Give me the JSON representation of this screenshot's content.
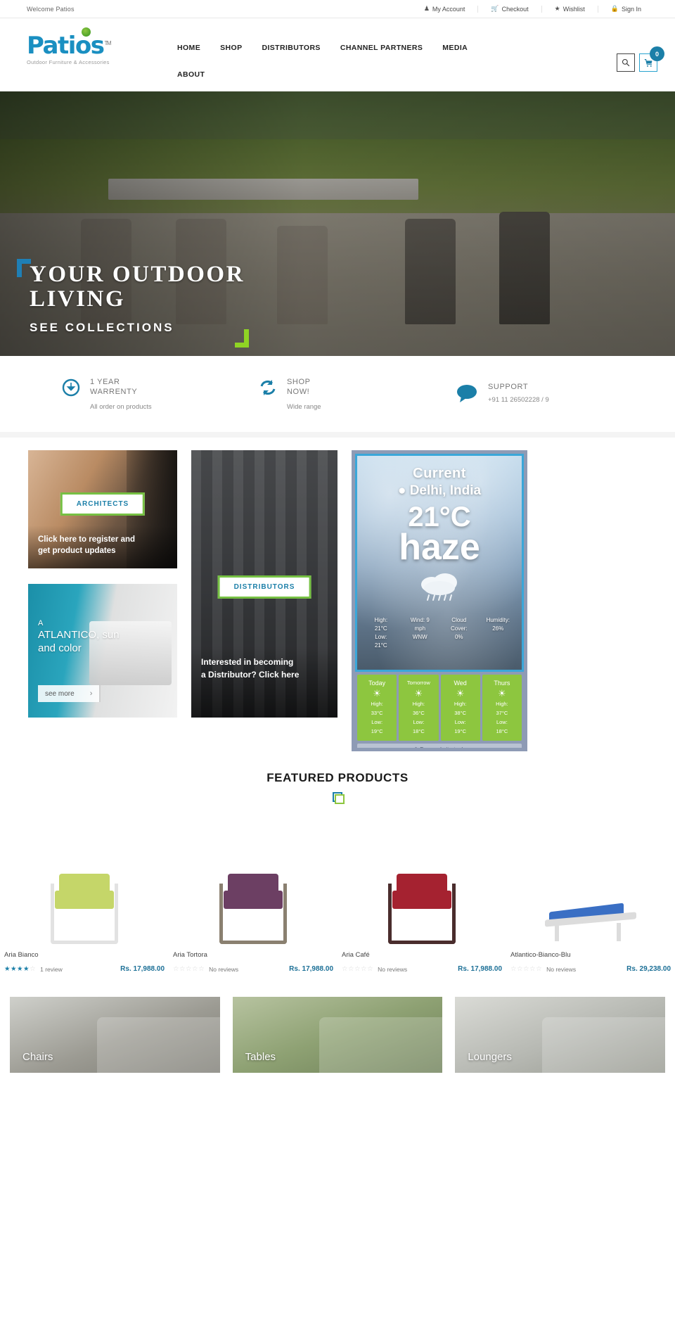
{
  "topbar": {
    "welcome": "Welcome  Patios",
    "links": [
      {
        "label": "My Account",
        "icon": "user-icon",
        "glyph": "●"
      },
      {
        "label": "Checkout",
        "icon": "checkout-icon",
        "glyph": "▤"
      },
      {
        "label": "Wishlist",
        "icon": "star-icon",
        "glyph": "★"
      },
      {
        "label": "Sign In",
        "icon": "lock-icon",
        "glyph": "▮"
      }
    ]
  },
  "header": {
    "logo_text": "Patios",
    "logo_tm": "TM",
    "logo_tagline": "Outdoor Furniture & Accessories",
    "nav": [
      {
        "label": "HOME"
      },
      {
        "label": "SHOP"
      },
      {
        "label": "DISTRIBUTORS"
      },
      {
        "label": "CHANNEL PARTNERS"
      },
      {
        "label": "MEDIA"
      },
      {
        "label": "ABOUT"
      }
    ],
    "search_icon": "search-icon",
    "cart_icon": "cart-icon",
    "cart_count": "0"
  },
  "hero": {
    "line1": "YOUR OUTDOOR",
    "line2": "LIVING",
    "cta": "SEE COLLECTIONS",
    "bracket_blue": "#1f7fb5",
    "bracket_green": "#8fd424"
  },
  "features": [
    {
      "icon": "download-circle-icon",
      "title": "1  YEAR\nWARRENTY",
      "title_l1": "1  YEAR",
      "title_l2": "WARRENTY",
      "desc": "All order on products"
    },
    {
      "icon": "refresh-icon",
      "title_l1": "SHOP",
      "title_l2": "NOW!",
      "desc": "Wide range"
    },
    {
      "icon": "chat-bubble-icon",
      "title_l1": "SUPPORT",
      "title_l2": "+91 11 26502228 / 9",
      "desc": ""
    }
  ],
  "promos": {
    "architects": {
      "button": "ARCHITECTS",
      "caption_l1": "Click here to register and",
      "caption_l2": "get product updates"
    },
    "atlantico": {
      "line1": "ATLANTICO, sun",
      "line2": "and color",
      "see_more": "see more",
      "chevron": "›"
    },
    "distributors": {
      "button": "DISTRIBUTORS",
      "caption_l1": "Interested in becoming",
      "caption_l2": "a Distributor? Click here"
    }
  },
  "weather": {
    "current_label": "Current",
    "location": "Delhi, India",
    "pin_icon": "location-pin-icon",
    "temperature": "21°C",
    "condition": "haze",
    "condition_icon": "cloud-icon",
    "stats": [
      {
        "label": "High:",
        "l2": "21°C",
        "l3": "Low:",
        "l4": "21°C"
      },
      {
        "label": "Wind: 9",
        "l2": "mph",
        "l3": "WNW",
        "l4": ""
      },
      {
        "label": "Cloud",
        "l2": "Cover:",
        "l3": "0%",
        "l4": ""
      },
      {
        "label": "Humidity:",
        "l2": "26%",
        "l3": "",
        "l4": ""
      }
    ],
    "forecast": [
      {
        "day": "Today",
        "icon": "sun-icon",
        "high": "High:",
        "high_v": "33°C",
        "low": "Low:",
        "low_v": "19°C"
      },
      {
        "day": "Tomorrow",
        "icon": "sun-icon",
        "high": "High:",
        "high_v": "36°C",
        "low": "Low:",
        "low_v": "18°C"
      },
      {
        "day": "Wed",
        "icon": "sun-icon",
        "high": "High:",
        "high_v": "38°C",
        "low": "Low:",
        "low_v": "19°C"
      },
      {
        "day": "Thurs",
        "icon": "sun-icon",
        "high": "High:",
        "high_v": "37°C",
        "low": "Low:",
        "low_v": "18°C"
      }
    ],
    "footer": "⚘ Free website tools",
    "accent": "#3aa7d9",
    "forecast_color": "#8dc63f"
  },
  "featured": {
    "title": "FEATURED PRODUCTS",
    "products": [
      {
        "name": "Aria Bianco",
        "stars_on": 4,
        "stars_total": 5,
        "reviews": "1 review",
        "price": "Rs. 17,988.00",
        "seat_color": "#c5d669",
        "frame_color": "#e2e2e2",
        "type": "chair"
      },
      {
        "name": "Aria Tortora",
        "stars_on": 0,
        "stars_total": 5,
        "reviews": "No reviews",
        "price": "Rs. 17,988.00",
        "seat_color": "#6c3f63",
        "frame_color": "#8a8070",
        "type": "chair"
      },
      {
        "name": "Aria Café",
        "stars_on": 0,
        "stars_total": 5,
        "reviews": "No reviews",
        "price": "Rs. 17,988.00",
        "seat_color": "#a52230",
        "frame_color": "#4a2d2d",
        "type": "chair"
      },
      {
        "name": "Atlantico-Bianco-Blu",
        "stars_on": 0,
        "stars_total": 5,
        "reviews": "No reviews",
        "price": "Rs. 29,238.00",
        "seat_color": "#3a6fc4",
        "frame_color": "#dedede",
        "type": "lounger"
      }
    ]
  },
  "categories": [
    {
      "label": "Chairs"
    },
    {
      "label": "Tables"
    },
    {
      "label": "Loungers"
    }
  ]
}
